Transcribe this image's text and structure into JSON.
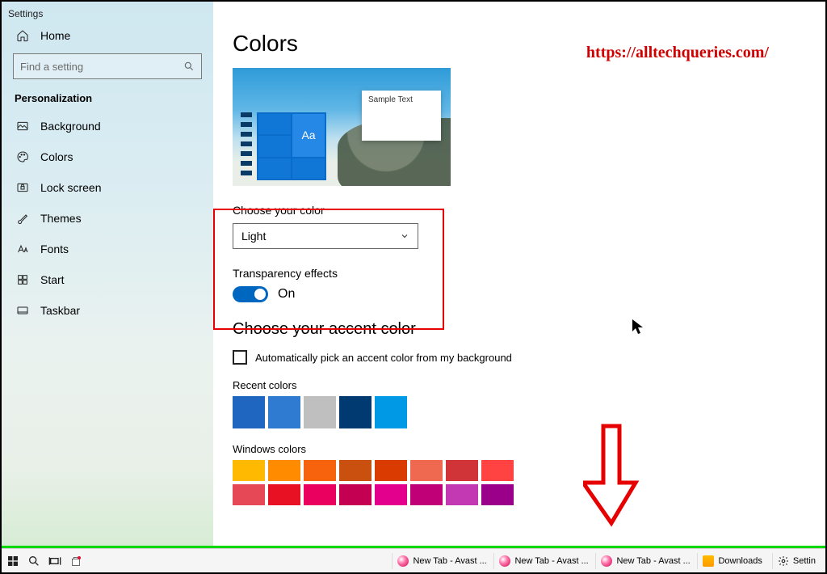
{
  "window_title": "Settings",
  "sidebar": {
    "home": "Home",
    "search_placeholder": "Find a setting",
    "section": "Personalization",
    "items": [
      {
        "icon": "image-icon",
        "label": "Background"
      },
      {
        "icon": "palette-icon",
        "label": "Colors"
      },
      {
        "icon": "lock-icon",
        "label": "Lock screen"
      },
      {
        "icon": "brush-icon",
        "label": "Themes"
      },
      {
        "icon": "font-icon",
        "label": "Fonts"
      },
      {
        "icon": "grid-icon",
        "label": "Start"
      },
      {
        "icon": "taskbar-icon",
        "label": "Taskbar"
      }
    ]
  },
  "page": {
    "title": "Colors",
    "preview_sample": "Sample Text",
    "preview_aa": "Aa",
    "choose_color_label": "Choose your color",
    "choose_color_value": "Light",
    "transparency_label": "Transparency effects",
    "transparency_value": "On",
    "accent_heading": "Choose your accent color",
    "auto_pick_label": "Automatically pick an accent color from my background",
    "recent_label": "Recent colors",
    "recent_colors": [
      "#1f66c1",
      "#2f7bd1",
      "#bfbfbf",
      "#003a70",
      "#0099e6"
    ],
    "windows_label": "Windows colors",
    "windows_colors": [
      "#ffb900",
      "#ff8c00",
      "#f7630c",
      "#ca5010",
      "#da3b01",
      "#ef6950",
      "#d13438",
      "#ff4343",
      "#e74856",
      "#e81123",
      "#ea005e",
      "#c30052",
      "#e3008c",
      "#bf0077",
      "#c239b3",
      "#9a0089"
    ]
  },
  "overlay": {
    "url": "https://alltechqueries.com/"
  },
  "taskbar": {
    "tabs": [
      "New Tab - Avast ...",
      "New Tab - Avast ...",
      "New Tab - Avast ..."
    ],
    "downloads": "Downloads",
    "settings": "Settin"
  }
}
